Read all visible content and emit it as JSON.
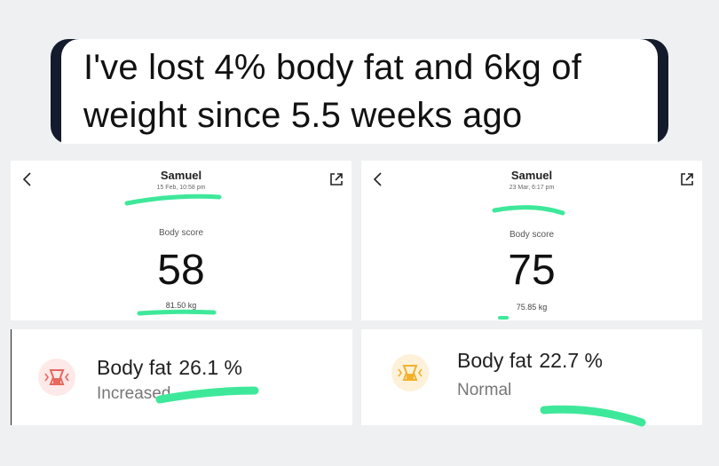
{
  "caption": {
    "line1": "I've lost 4% body fat and 6kg of",
    "line2": "weight since 5.5 weeks ago"
  },
  "before": {
    "name": "Samuel",
    "date": "15 Feb, 10:58 pm",
    "score_label": "Body score",
    "score": "58",
    "weight": "81.50 kg",
    "fat_label": "Body fat",
    "fat_value": "26.1 %",
    "fat_status": "Increased",
    "status_color": "#e8675f"
  },
  "after": {
    "name": "Samuel",
    "date": "23 Mar, 6:17 pm",
    "score_label": "Body score",
    "score": "75",
    "weight": "75.85 kg",
    "fat_label": "Body fat",
    "fat_value": "22.7 %",
    "fat_status": "Normal",
    "status_color": "#f2b12c"
  },
  "icons": {
    "back": "chevron-left-icon",
    "share": "share-external-icon",
    "body_fat": "body-fat-icon"
  },
  "highlight_color": "#3ee89a"
}
